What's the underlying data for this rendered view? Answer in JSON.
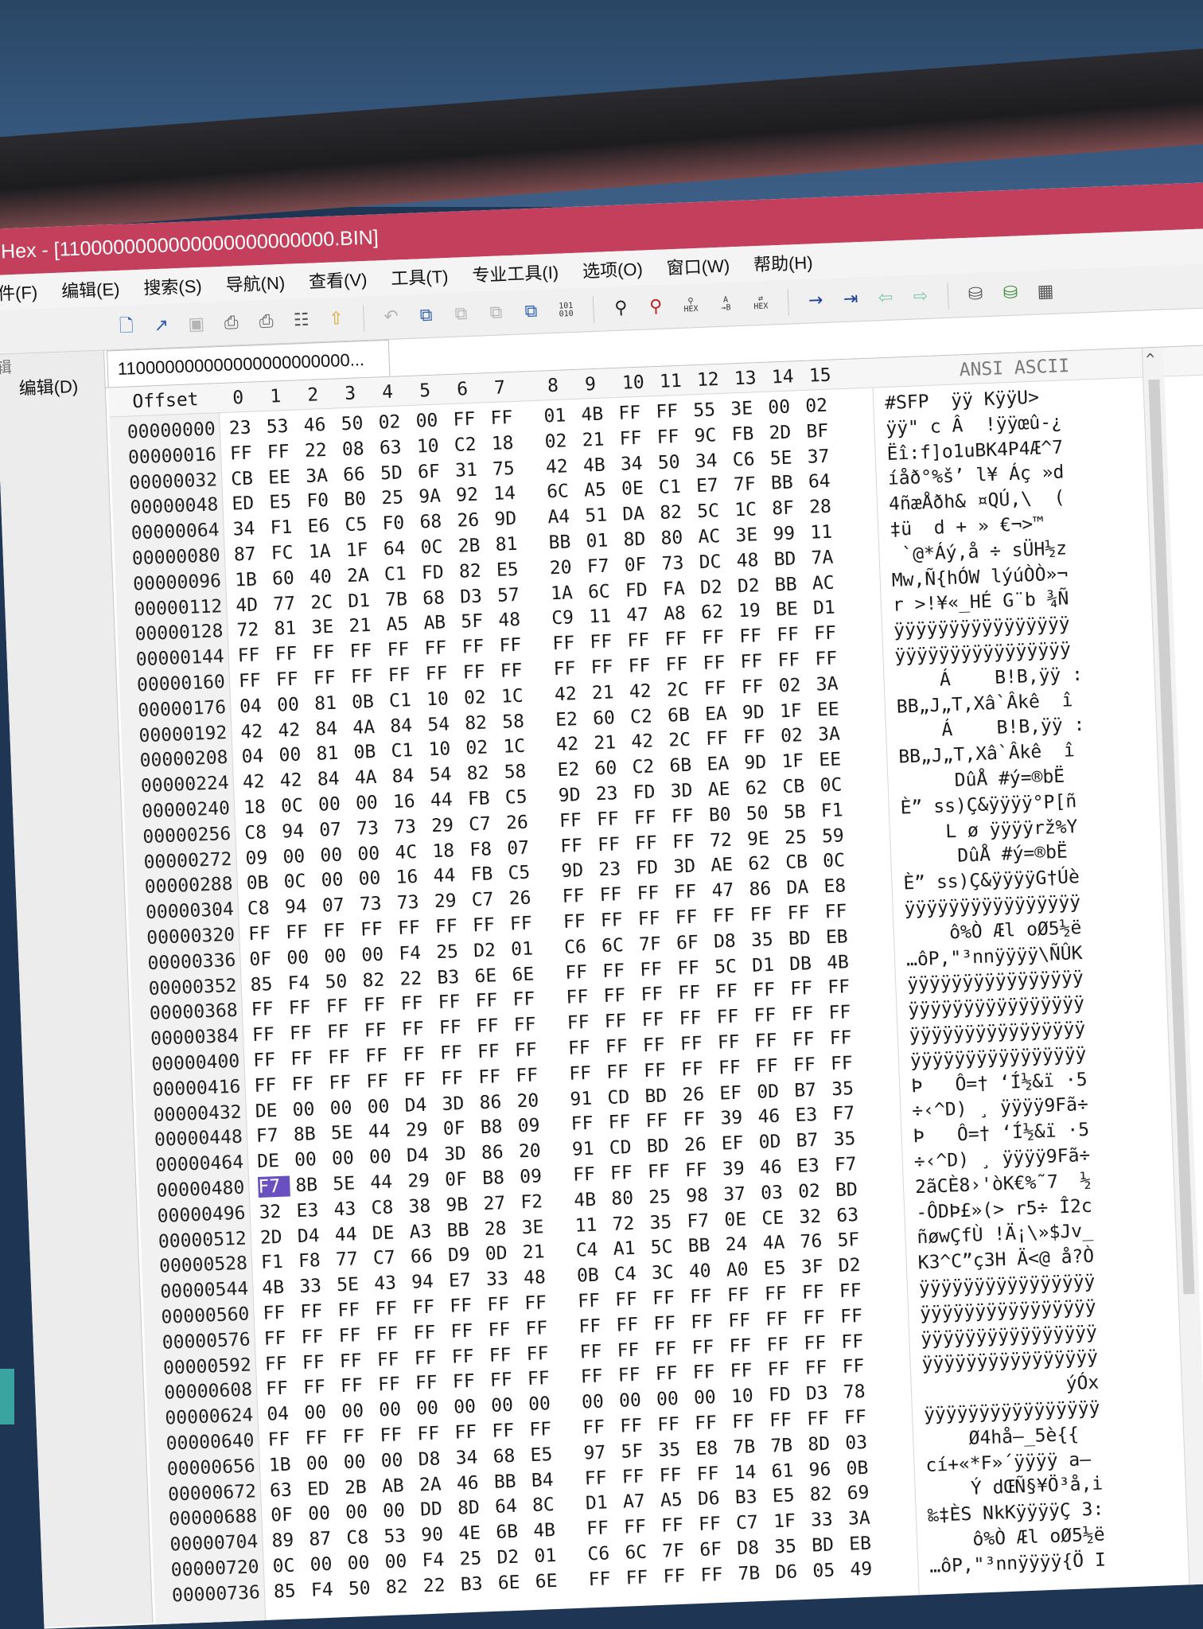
{
  "window": {
    "title": "Hex - [1100000000000000000000000.BIN]"
  },
  "menu": [
    "件(F)",
    "编辑(E)",
    "搜索(S)",
    "导航(N)",
    "查看(V)",
    "工具(T)",
    "专业工具(I)",
    "选项(O)",
    "窗口(W)",
    "帮助(H)"
  ],
  "toolbar_icons": [
    "new-file-icon",
    "open-icon",
    "save-icon",
    "print-icon",
    "print-preview-icon",
    "properties-icon",
    "export-icon",
    "undo-icon",
    "copy-icon",
    "cut-icon",
    "paste-icon",
    "paste-special-icon",
    "binary-101-010-icon",
    "find-icon",
    "find-replace-icon",
    "find-hex-icon",
    "find-text-icon",
    "replace-hex-icon",
    "goto-arrow-icon",
    "goto-offset-icon",
    "back-icon",
    "forward-icon",
    "disk-icon",
    "disk-add-icon",
    "chip-icon"
  ],
  "left_panel": {
    "label": "编辑(D)",
    "cut_label": "辑"
  },
  "file_tab": {
    "label": "110000000000000000000000..."
  },
  "hex_view": {
    "offset_header": "Offset",
    "column_headers": [
      "0",
      "1",
      "2",
      "3",
      "4",
      "5",
      "6",
      "7",
      "8",
      "9",
      "10",
      "11",
      "12",
      "13",
      "14",
      "15"
    ],
    "ascii_header": "ANSI ASCII",
    "rows": [
      {
        "offset": "00000000",
        "bytes": [
          "23",
          "53",
          "46",
          "50",
          "02",
          "00",
          "FF",
          "FF",
          "01",
          "4B",
          "FF",
          "FF",
          "55",
          "3E",
          "00",
          "02"
        ],
        "ascii": "#SFP  ÿÿ KÿÿU>"
      },
      {
        "offset": "00000016",
        "bytes": [
          "FF",
          "FF",
          "22",
          "08",
          "63",
          "10",
          "C2",
          "18",
          "02",
          "21",
          "FF",
          "FF",
          "9C",
          "FB",
          "2D",
          "BF"
        ],
        "ascii": "ÿÿ\" c Â  !ÿÿœû-¿"
      },
      {
        "offset": "00000032",
        "bytes": [
          "CB",
          "EE",
          "3A",
          "66",
          "5D",
          "6F",
          "31",
          "75",
          "42",
          "4B",
          "34",
          "50",
          "34",
          "C6",
          "5E",
          "37"
        ],
        "ascii": "Ëî:f]o1uBK4P4Æ^7"
      },
      {
        "offset": "00000048",
        "bytes": [
          "ED",
          "E5",
          "F0",
          "B0",
          "25",
          "9A",
          "92",
          "14",
          "6C",
          "A5",
          "0E",
          "C1",
          "E7",
          "7F",
          "BB",
          "64"
        ],
        "ascii": "íåð°%š’ l¥ Áç »d"
      },
      {
        "offset": "00000064",
        "bytes": [
          "34",
          "F1",
          "E6",
          "C5",
          "F0",
          "68",
          "26",
          "9D",
          "A4",
          "51",
          "DA",
          "82",
          "5C",
          "1C",
          "8F",
          "28"
        ],
        "ascii": "4ñæÅðh& ¤QÚ‚\\  ("
      },
      {
        "offset": "00000080",
        "bytes": [
          "87",
          "FC",
          "1A",
          "1F",
          "64",
          "0C",
          "2B",
          "81",
          "BB",
          "01",
          "8D",
          "80",
          "AC",
          "3E",
          "99",
          "11"
        ],
        "ascii": "‡ü  d + » €¬>™"
      },
      {
        "offset": "00000096",
        "bytes": [
          "1B",
          "60",
          "40",
          "2A",
          "C1",
          "FD",
          "82",
          "E5",
          "20",
          "F7",
          "0F",
          "73",
          "DC",
          "48",
          "BD",
          "7A"
        ],
        "ascii": " `@*Áý‚å ÷ sÜH½z"
      },
      {
        "offset": "00000112",
        "bytes": [
          "4D",
          "77",
          "2C",
          "D1",
          "7B",
          "68",
          "D3",
          "57",
          "1A",
          "6C",
          "FD",
          "FA",
          "D2",
          "D2",
          "BB",
          "AC"
        ],
        "ascii": "Mw,Ñ{hÓW lýúÒÒ»¬"
      },
      {
        "offset": "00000128",
        "bytes": [
          "72",
          "81",
          "3E",
          "21",
          "A5",
          "AB",
          "5F",
          "48",
          "C9",
          "11",
          "47",
          "A8",
          "62",
          "19",
          "BE",
          "D1"
        ],
        "ascii": "r >!¥«_HÉ G¨b ¾Ñ"
      },
      {
        "offset": "00000144",
        "bytes": [
          "FF",
          "FF",
          "FF",
          "FF",
          "FF",
          "FF",
          "FF",
          "FF",
          "FF",
          "FF",
          "FF",
          "FF",
          "FF",
          "FF",
          "FF",
          "FF"
        ],
        "ascii": "ÿÿÿÿÿÿÿÿÿÿÿÿÿÿÿÿ"
      },
      {
        "offset": "00000160",
        "bytes": [
          "FF",
          "FF",
          "FF",
          "FF",
          "FF",
          "FF",
          "FF",
          "FF",
          "FF",
          "FF",
          "FF",
          "FF",
          "FF",
          "FF",
          "FF",
          "FF"
        ],
        "ascii": "ÿÿÿÿÿÿÿÿÿÿÿÿÿÿÿÿ"
      },
      {
        "offset": "00000176",
        "bytes": [
          "04",
          "00",
          "81",
          "0B",
          "C1",
          "10",
          "02",
          "1C",
          "42",
          "21",
          "42",
          "2C",
          "FF",
          "FF",
          "02",
          "3A"
        ],
        "ascii": "    Á    B!B,ÿÿ :"
      },
      {
        "offset": "00000192",
        "bytes": [
          "42",
          "42",
          "84",
          "4A",
          "84",
          "54",
          "82",
          "58",
          "E2",
          "60",
          "C2",
          "6B",
          "EA",
          "9D",
          "1F",
          "EE"
        ],
        "ascii": "BB„J„T‚Xâ`Âkê  î"
      },
      {
        "offset": "00000208",
        "bytes": [
          "04",
          "00",
          "81",
          "0B",
          "C1",
          "10",
          "02",
          "1C",
          "42",
          "21",
          "42",
          "2C",
          "FF",
          "FF",
          "02",
          "3A"
        ],
        "ascii": "    Á    B!B,ÿÿ :"
      },
      {
        "offset": "00000224",
        "bytes": [
          "42",
          "42",
          "84",
          "4A",
          "84",
          "54",
          "82",
          "58",
          "E2",
          "60",
          "C2",
          "6B",
          "EA",
          "9D",
          "1F",
          "EE"
        ],
        "ascii": "BB„J„T‚Xâ`Âkê  î"
      },
      {
        "offset": "00000240",
        "bytes": [
          "18",
          "0C",
          "00",
          "00",
          "16",
          "44",
          "FB",
          "C5",
          "9D",
          "23",
          "FD",
          "3D",
          "AE",
          "62",
          "CB",
          "0C"
        ],
        "ascii": "     DûÅ #ý=®bË"
      },
      {
        "offset": "00000256",
        "bytes": [
          "C8",
          "94",
          "07",
          "73",
          "73",
          "29",
          "C7",
          "26",
          "FF",
          "FF",
          "FF",
          "FF",
          "B0",
          "50",
          "5B",
          "F1"
        ],
        "ascii": "È” ss)Ç&ÿÿÿÿ°P[ñ"
      },
      {
        "offset": "00000272",
        "bytes": [
          "09",
          "00",
          "00",
          "00",
          "4C",
          "18",
          "F8",
          "07",
          "FF",
          "FF",
          "FF",
          "FF",
          "72",
          "9E",
          "25",
          "59"
        ],
        "ascii": "    L ø ÿÿÿÿrž%Y"
      },
      {
        "offset": "00000288",
        "bytes": [
          "0B",
          "0C",
          "00",
          "00",
          "16",
          "44",
          "FB",
          "C5",
          "9D",
          "23",
          "FD",
          "3D",
          "AE",
          "62",
          "CB",
          "0C"
        ],
        "ascii": "     DûÅ #ý=®bË"
      },
      {
        "offset": "00000304",
        "bytes": [
          "C8",
          "94",
          "07",
          "73",
          "73",
          "29",
          "C7",
          "26",
          "FF",
          "FF",
          "FF",
          "FF",
          "47",
          "86",
          "DA",
          "E8"
        ],
        "ascii": "È” ss)Ç&ÿÿÿÿG†Úè"
      },
      {
        "offset": "00000320",
        "bytes": [
          "FF",
          "FF",
          "FF",
          "FF",
          "FF",
          "FF",
          "FF",
          "FF",
          "FF",
          "FF",
          "FF",
          "FF",
          "FF",
          "FF",
          "FF",
          "FF"
        ],
        "ascii": "ÿÿÿÿÿÿÿÿÿÿÿÿÿÿÿÿ"
      },
      {
        "offset": "00000336",
        "bytes": [
          "0F",
          "00",
          "00",
          "00",
          "F4",
          "25",
          "D2",
          "01",
          "C6",
          "6C",
          "7F",
          "6F",
          "D8",
          "35",
          "BD",
          "EB"
        ],
        "ascii": "    ô%Ò Æl oØ5½ë"
      },
      {
        "offset": "00000352",
        "bytes": [
          "85",
          "F4",
          "50",
          "82",
          "22",
          "B3",
          "6E",
          "6E",
          "FF",
          "FF",
          "FF",
          "FF",
          "5C",
          "D1",
          "DB",
          "4B"
        ],
        "ascii": "…ôP‚\"³nnÿÿÿÿ\\ÑÛK"
      },
      {
        "offset": "00000368",
        "bytes": [
          "FF",
          "FF",
          "FF",
          "FF",
          "FF",
          "FF",
          "FF",
          "FF",
          "FF",
          "FF",
          "FF",
          "FF",
          "FF",
          "FF",
          "FF",
          "FF"
        ],
        "ascii": "ÿÿÿÿÿÿÿÿÿÿÿÿÿÿÿÿ"
      },
      {
        "offset": "00000384",
        "bytes": [
          "FF",
          "FF",
          "FF",
          "FF",
          "FF",
          "FF",
          "FF",
          "FF",
          "FF",
          "FF",
          "FF",
          "FF",
          "FF",
          "FF",
          "FF",
          "FF"
        ],
        "ascii": "ÿÿÿÿÿÿÿÿÿÿÿÿÿÿÿÿ"
      },
      {
        "offset": "00000400",
        "bytes": [
          "FF",
          "FF",
          "FF",
          "FF",
          "FF",
          "FF",
          "FF",
          "FF",
          "FF",
          "FF",
          "FF",
          "FF",
          "FF",
          "FF",
          "FF",
          "FF"
        ],
        "ascii": "ÿÿÿÿÿÿÿÿÿÿÿÿÿÿÿÿ"
      },
      {
        "offset": "00000416",
        "bytes": [
          "FF",
          "FF",
          "FF",
          "FF",
          "FF",
          "FF",
          "FF",
          "FF",
          "FF",
          "FF",
          "FF",
          "FF",
          "FF",
          "FF",
          "FF",
          "FF"
        ],
        "ascii": "ÿÿÿÿÿÿÿÿÿÿÿÿÿÿÿÿ"
      },
      {
        "offset": "00000432",
        "bytes": [
          "DE",
          "00",
          "00",
          "00",
          "D4",
          "3D",
          "86",
          "20",
          "91",
          "CD",
          "BD",
          "26",
          "EF",
          "0D",
          "B7",
          "35"
        ],
        "ascii": "Þ   Ô=† ‘Í½&ï ·5"
      },
      {
        "offset": "00000448",
        "bytes": [
          "F7",
          "8B",
          "5E",
          "44",
          "29",
          "0F",
          "B8",
          "09",
          "FF",
          "FF",
          "FF",
          "FF",
          "39",
          "46",
          "E3",
          "F7"
        ],
        "ascii": "÷‹^D) ¸ ÿÿÿÿ9Fã÷"
      },
      {
        "offset": "00000464",
        "bytes": [
          "DE",
          "00",
          "00",
          "00",
          "D4",
          "3D",
          "86",
          "20",
          "91",
          "CD",
          "BD",
          "26",
          "EF",
          "0D",
          "B7",
          "35"
        ],
        "ascii": "Þ   Ô=† ‘Í½&ï ·5"
      },
      {
        "offset": "00000480",
        "bytes": [
          "F7",
          "8B",
          "5E",
          "44",
          "29",
          "0F",
          "B8",
          "09",
          "FF",
          "FF",
          "FF",
          "FF",
          "39",
          "46",
          "E3",
          "F7"
        ],
        "ascii": "÷‹^D) ¸ ÿÿÿÿ9Fã÷"
      },
      {
        "offset": "00000496",
        "bytes": [
          "32",
          "E3",
          "43",
          "C8",
          "38",
          "9B",
          "27",
          "F2",
          "4B",
          "80",
          "25",
          "98",
          "37",
          "03",
          "02",
          "BD"
        ],
        "ascii": "2ãCÈ8›'òK€%˜7  ½"
      },
      {
        "offset": "00000512",
        "bytes": [
          "2D",
          "D4",
          "44",
          "DE",
          "A3",
          "BB",
          "28",
          "3E",
          "11",
          "72",
          "35",
          "F7",
          "0E",
          "CE",
          "32",
          "63"
        ],
        "ascii": "-ÔDÞ£»(> r5÷ Î2c"
      },
      {
        "offset": "00000528",
        "bytes": [
          "F1",
          "F8",
          "77",
          "C7",
          "66",
          "D9",
          "0D",
          "21",
          "C4",
          "A1",
          "5C",
          "BB",
          "24",
          "4A",
          "76",
          "5F"
        ],
        "ascii": "ñøwÇfÙ !Ä¡\\»$Jv_"
      },
      {
        "offset": "00000544",
        "bytes": [
          "4B",
          "33",
          "5E",
          "43",
          "94",
          "E7",
          "33",
          "48",
          "0B",
          "C4",
          "3C",
          "40",
          "A0",
          "E5",
          "3F",
          "D2"
        ],
        "ascii": "K3^C”ç3H Ä<@ å?Ò"
      },
      {
        "offset": "00000560",
        "bytes": [
          "FF",
          "FF",
          "FF",
          "FF",
          "FF",
          "FF",
          "FF",
          "FF",
          "FF",
          "FF",
          "FF",
          "FF",
          "FF",
          "FF",
          "FF",
          "FF"
        ],
        "ascii": "ÿÿÿÿÿÿÿÿÿÿÿÿÿÿÿÿ"
      },
      {
        "offset": "00000576",
        "bytes": [
          "FF",
          "FF",
          "FF",
          "FF",
          "FF",
          "FF",
          "FF",
          "FF",
          "FF",
          "FF",
          "FF",
          "FF",
          "FF",
          "FF",
          "FF",
          "FF"
        ],
        "ascii": "ÿÿÿÿÿÿÿÿÿÿÿÿÿÿÿÿ"
      },
      {
        "offset": "00000592",
        "bytes": [
          "FF",
          "FF",
          "FF",
          "FF",
          "FF",
          "FF",
          "FF",
          "FF",
          "FF",
          "FF",
          "FF",
          "FF",
          "FF",
          "FF",
          "FF",
          "FF"
        ],
        "ascii": "ÿÿÿÿÿÿÿÿÿÿÿÿÿÿÿÿ"
      },
      {
        "offset": "00000608",
        "bytes": [
          "FF",
          "FF",
          "FF",
          "FF",
          "FF",
          "FF",
          "FF",
          "FF",
          "FF",
          "FF",
          "FF",
          "FF",
          "FF",
          "FF",
          "FF",
          "FF"
        ],
        "ascii": "ÿÿÿÿÿÿÿÿÿÿÿÿÿÿÿÿ"
      },
      {
        "offset": "00000624",
        "bytes": [
          "04",
          "00",
          "00",
          "00",
          "00",
          "00",
          "00",
          "00",
          "00",
          "00",
          "00",
          "00",
          "10",
          "FD",
          "D3",
          "78"
        ],
        "ascii": "             ýÓx"
      },
      {
        "offset": "00000640",
        "bytes": [
          "FF",
          "FF",
          "FF",
          "FF",
          "FF",
          "FF",
          "FF",
          "FF",
          "FF",
          "FF",
          "FF",
          "FF",
          "FF",
          "FF",
          "FF",
          "FF"
        ],
        "ascii": "ÿÿÿÿÿÿÿÿÿÿÿÿÿÿÿÿ"
      },
      {
        "offset": "00000656",
        "bytes": [
          "1B",
          "00",
          "00",
          "00",
          "D8",
          "34",
          "68",
          "E5",
          "97",
          "5F",
          "35",
          "E8",
          "7B",
          "7B",
          "8D",
          "03"
        ],
        "ascii": "    Ø4hå—_5è{{"
      },
      {
        "offset": "00000672",
        "bytes": [
          "63",
          "ED",
          "2B",
          "AB",
          "2A",
          "46",
          "BB",
          "B4",
          "FF",
          "FF",
          "FF",
          "FF",
          "14",
          "61",
          "96",
          "0B"
        ],
        "ascii": "cí+«*F»´ÿÿÿÿ a–"
      },
      {
        "offset": "00000688",
        "bytes": [
          "0F",
          "00",
          "00",
          "00",
          "DD",
          "8D",
          "64",
          "8C",
          "D1",
          "A7",
          "A5",
          "D6",
          "B3",
          "E5",
          "82",
          "69"
        ],
        "ascii": "    Ý dŒÑ§¥Ö³å‚i"
      },
      {
        "offset": "00000704",
        "bytes": [
          "89",
          "87",
          "C8",
          "53",
          "90",
          "4E",
          "6B",
          "4B",
          "FF",
          "FF",
          "FF",
          "FF",
          "C7",
          "1F",
          "33",
          "3A"
        ],
        "ascii": "‰‡ÈS NkKÿÿÿÿÇ 3:"
      },
      {
        "offset": "00000720",
        "bytes": [
          "0C",
          "00",
          "00",
          "00",
          "F4",
          "25",
          "D2",
          "01",
          "C6",
          "6C",
          "7F",
          "6F",
          "D8",
          "35",
          "BD",
          "EB"
        ],
        "ascii": "    ô%Ò Æl oØ5½ë"
      },
      {
        "offset": "00000736",
        "bytes": [
          "85",
          "F4",
          "50",
          "82",
          "22",
          "B3",
          "6E",
          "6E",
          "FF",
          "FF",
          "FF",
          "FF",
          "7B",
          "D6",
          "05",
          "49"
        ],
        "ascii": "…ôP‚\"³nnÿÿÿÿ{Ö I"
      }
    ]
  },
  "colors": {
    "title_bar": "#c33f5c",
    "selection": "#6a4fc0",
    "toolbar_blue": "#2a5db0"
  }
}
